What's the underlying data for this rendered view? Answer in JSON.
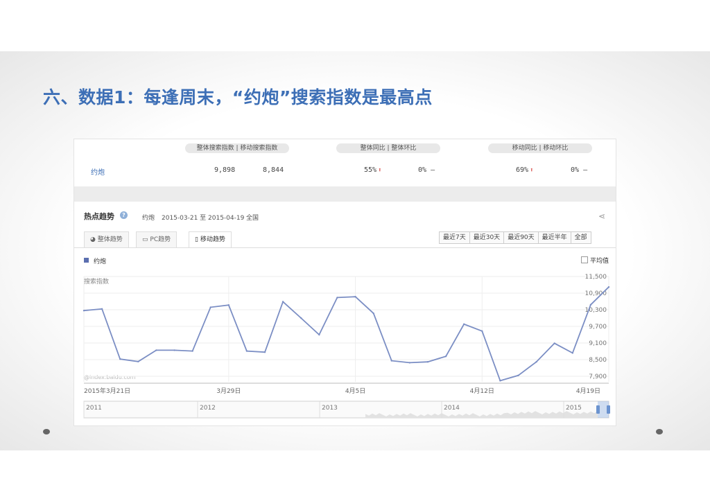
{
  "slide": {
    "title": "六、数据1：每逢周末，“约炮”搜索指数是最高点"
  },
  "summary": {
    "headers": {
      "index": "整体搜索指数  |  移动搜索指数",
      "overall": "整体同比  |  整体环比",
      "mobile": "移动同比  |  移动环比"
    },
    "keyword": "约炮",
    "overall_index": "9,898",
    "mobile_index": "8,844",
    "overall_yoy": "55%",
    "overall_mom": "0%",
    "mobile_yoy": "69%",
    "mobile_mom": "0%",
    "dash": "—",
    "up_arrow": "⬆"
  },
  "trend": {
    "title": "热点趋势",
    "help_icon": "?",
    "keyword": "约炮",
    "date_range": "2015-03-21 至 2015-04-19",
    "region": "全国",
    "share_icon": "⋖"
  },
  "tabs": [
    {
      "label": "整体趋势",
      "icon": "◕"
    },
    {
      "label": "PC趋势",
      "icon": "▭"
    },
    {
      "label": "移动趋势",
      "icon": "▯"
    }
  ],
  "ranges": [
    "最近7天",
    "最近30天",
    "最近90天",
    "最近半年",
    "全部"
  ],
  "legend": {
    "series": "约炮",
    "average": "平均值"
  },
  "y_axis_label": "搜索指数",
  "watermark": "@index.baidu.com",
  "colors": {
    "line": "#7b8ec4",
    "accent": "#3d6fb6",
    "up": "#d9534f"
  },
  "chart_data": {
    "type": "line",
    "x": [
      "2015-03-21",
      "2015-03-22",
      "2015-03-23",
      "2015-03-24",
      "2015-03-25",
      "2015-03-26",
      "2015-03-27",
      "2015-03-28",
      "2015-03-29",
      "2015-03-30",
      "2015-03-31",
      "2015-04-01",
      "2015-04-02",
      "2015-04-03",
      "2015-04-04",
      "2015-04-05",
      "2015-04-06",
      "2015-04-07",
      "2015-04-08",
      "2015-04-09",
      "2015-04-10",
      "2015-04-11",
      "2015-04-12",
      "2015-04-13",
      "2015-04-14",
      "2015-04-15",
      "2015-04-16",
      "2015-04-17",
      "2015-04-18",
      "2015-04-19"
    ],
    "series": [
      {
        "name": "约炮",
        "values": [
          10270,
          10330,
          8520,
          8430,
          8840,
          8840,
          8810,
          10390,
          10470,
          8810,
          8770,
          10590,
          10000,
          9400,
          10740,
          10770,
          10170,
          8460,
          8390,
          8420,
          8620,
          9780,
          9530,
          7740,
          7930,
          8420,
          9090,
          8740,
          10480,
          11120
        ]
      }
    ],
    "x_tick_labels": [
      "2015年3月21日",
      "3月29日",
      "4月5日",
      "4月12日",
      "4月19日"
    ],
    "y_tick_labels": [
      "11,500",
      "10,900",
      "10,300",
      "9,700",
      "9,100",
      "8,500",
      "7,900"
    ],
    "ylim": [
      7700,
      11500
    ],
    "grid": true,
    "legend": "top-left"
  },
  "navigator": {
    "years": [
      "2011",
      "2012",
      "2013",
      "2014",
      "2015"
    ]
  }
}
